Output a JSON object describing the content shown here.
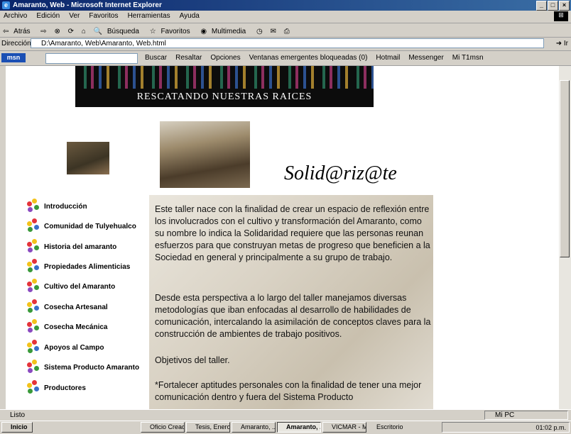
{
  "window": {
    "title": "Amaranto, Web - Microsoft Internet Explorer",
    "min": "_",
    "max": "□",
    "close": "×"
  },
  "menu": [
    "Archivo",
    "Edición",
    "Ver",
    "Favoritos",
    "Herramientas",
    "Ayuda"
  ],
  "toolbar": {
    "back": "Atrás",
    "search": "Búsqueda",
    "favorites": "Favoritos",
    "media": "Multimedia"
  },
  "address": {
    "label": "Dirección",
    "value": "D:\\Amaranto, Web\\Amaranto, Web.html",
    "go": "Ir"
  },
  "msnbar": {
    "logo": "msn",
    "buttons": [
      "Buscar",
      "Resaltar",
      "Opciones",
      "Ventanas emergentes bloqueadas (0)",
      "Hotmail",
      "Messenger",
      "Mi T1msn"
    ]
  },
  "page": {
    "banner_text": "RESCATANDO NUESTRAS RAICES",
    "heading": "Solid@riz@te",
    "menu_items": [
      "Introducción",
      "Comunidad de Tulyehualco",
      "Historia del amaranto",
      "Propiedades Alimenticias",
      "Cultivo del Amaranto",
      "Cosecha Artesanal",
      "Cosecha Mecánica",
      "Apoyos al Campo",
      "Sistema Producto Amaranto",
      "Productores"
    ],
    "paragraphs": [
      "Este taller nace con la finalidad de crear un espacio de reflexión entre los involucrados con el cultivo y transformación del Amaranto, como su nombre lo indica la Solidaridad requiere que las personas reunan esfuerzos para que construyan metas de progreso que beneficien a la Sociedad en general y principalmente a su grupo de trabajo.",
      "Desde esta perspectiva a lo largo del taller manejamos diversas metodologías que iban enfocadas al desarrollo de habilidades de comunicación, intercalando la asimilación de conceptos claves para la construcción de ambientes de trabajo positivos.",
      "Objetivos del taller.",
      "*Fortalecer aptitudes personales con la finalidad de tener una mejor comunicación dentro y fuera del Sistema Producto"
    ]
  },
  "status": {
    "text": "Listo",
    "zone": "Mi PC"
  },
  "taskbar": {
    "start": "Inicio",
    "buttons": [
      "Oficio Cread...",
      "Tesis, Enero...",
      "Amaranto, ...",
      "Amaranto, ...",
      "VICMAR - Mi..."
    ],
    "desktop": "Escritorio",
    "clock": "01:02 p.m."
  }
}
